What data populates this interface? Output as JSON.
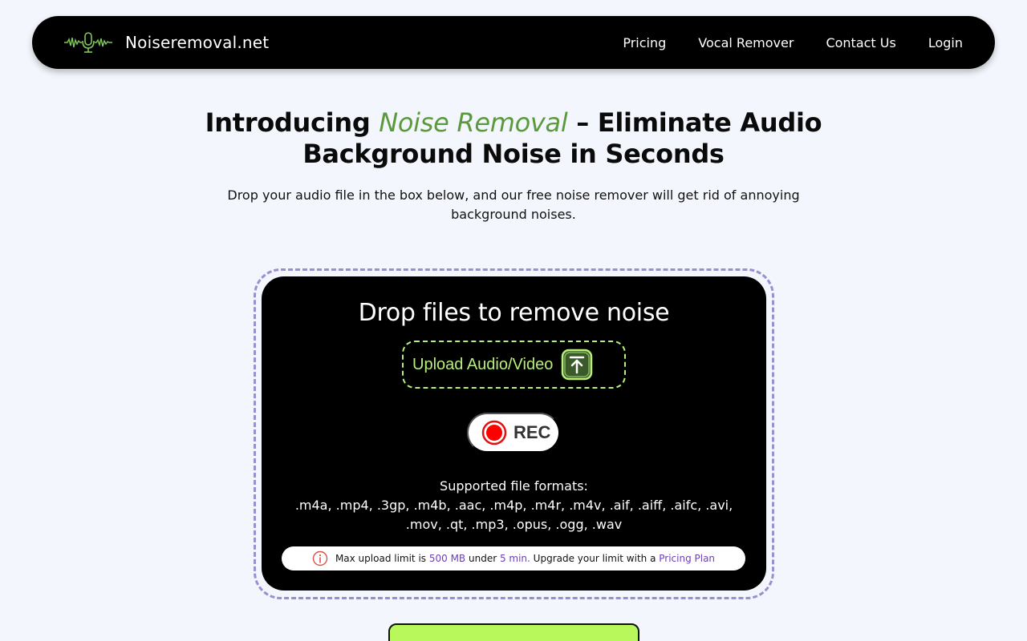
{
  "nav": {
    "brand": "Noiseremoval.net",
    "links": [
      {
        "label": "Pricing"
      },
      {
        "label": "Vocal Remover"
      },
      {
        "label": "Contact Us"
      },
      {
        "label": "Login"
      }
    ]
  },
  "hero": {
    "title_prefix": "Introducing ",
    "title_accent": "Noise Removal",
    "title_suffix": " – Eliminate Audio Background Noise in Seconds",
    "subtitle": "Drop your audio file in the box below, and our free noise remover will get rid of annoying background noises."
  },
  "upload": {
    "title": "Drop files to remove noise",
    "upload_label": "Upload Audio/Video",
    "rec_label": "REC",
    "formats_heading": "Supported file formats:",
    "formats_list": ".m4a, .mp4, .3gp, .m4b, .aac, .m4p, .m4r, .m4v, .aif, .aiff, .aifc, .avi, .mov, .qt, .mp3, .opus, .ogg, .wav",
    "limit": {
      "text_1": "Max upload limit is ",
      "size": "500 MB",
      "text_2": " under ",
      "duration": "5 min.",
      "text_3": " Upgrade your limit with a ",
      "plan_link": "Pricing Plan"
    }
  },
  "colors": {
    "accent_green": "#5a9a3a",
    "lime": "#b7ef7a",
    "dashed_border": "#9a8fd0",
    "link_purple": "#6c3fb5"
  },
  "icons": {
    "brand": "microphone-waveform-icon",
    "upload": "upload-arrow-icon",
    "record": "record-dot-icon",
    "info": "info-icon"
  }
}
